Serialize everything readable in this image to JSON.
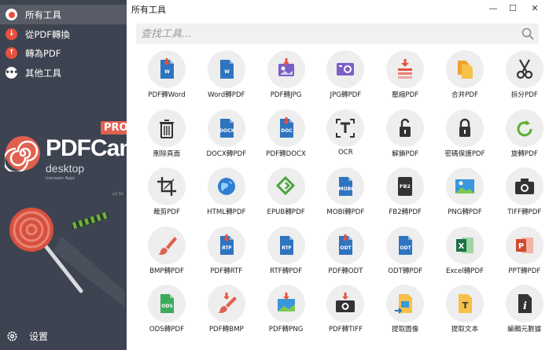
{
  "sidebar": {
    "items": [
      {
        "label": "所有工具",
        "icon": "all-tools-icon"
      },
      {
        "label": "從PDF轉換",
        "icon": "from-pdf-icon"
      },
      {
        "label": "轉為PDF",
        "icon": "to-pdf-icon"
      },
      {
        "label": "其他工具",
        "icon": "more-icon"
      }
    ],
    "logo": {
      "brand": "PDFCandy",
      "sub": "desktop",
      "badge": "PRO",
      "tiny": "Icecream Apps"
    },
    "version": "v2.91",
    "settings_label": "设置"
  },
  "window": {
    "title": "所有工具",
    "minimize": "—",
    "maximize": "☐",
    "close": "✕"
  },
  "search": {
    "placeholder": "查找工具..."
  },
  "colors": {
    "sidebar": "#3d4350",
    "active": "#575c66",
    "accent": "#e8513f",
    "word_blue": "#2f74c0",
    "excel_green": "#1e7145",
    "ppt_red": "#d04a2b"
  },
  "tools": [
    {
      "label": "PDF轉Word",
      "icon": "pdf-to-word-icon"
    },
    {
      "label": "Word轉PDF",
      "icon": "word-to-pdf-icon"
    },
    {
      "label": "PDF轉JPG",
      "icon": "pdf-to-jpg-icon"
    },
    {
      "label": "JPG轉PDF",
      "icon": "jpg-to-pdf-icon"
    },
    {
      "label": "壓縮PDF",
      "icon": "compress-icon"
    },
    {
      "label": "合并PDF",
      "icon": "merge-icon"
    },
    {
      "label": "拆分PDF",
      "icon": "scissors-icon"
    },
    {
      "label": "刪除頁面",
      "icon": "trash-icon"
    },
    {
      "label": "DOCX轉PDF",
      "icon": "docx-to-pdf-icon"
    },
    {
      "label": "PDF轉DOCX",
      "icon": "pdf-to-docx-icon"
    },
    {
      "label": "OCR",
      "icon": "ocr-icon"
    },
    {
      "label": "解鎖PDF",
      "icon": "unlock-icon"
    },
    {
      "label": "密碼保護PDF",
      "icon": "lock-icon"
    },
    {
      "label": "旋轉PDF",
      "icon": "rotate-icon"
    },
    {
      "label": "裁剪PDF",
      "icon": "crop-icon"
    },
    {
      "label": "HTML轉PDF",
      "icon": "html-globe-icon"
    },
    {
      "label": "EPUB轉PDF",
      "icon": "epub-icon"
    },
    {
      "label": "MOBI轉PDF",
      "icon": "mobi-icon"
    },
    {
      "label": "FB2轉PDF",
      "icon": "fb2-icon"
    },
    {
      "label": "PNG轉PDF",
      "icon": "png-image-icon"
    },
    {
      "label": "TIFF轉PDF",
      "icon": "camera-icon"
    },
    {
      "label": "BMP轉PDF",
      "icon": "paintbrush-icon"
    },
    {
      "label": "PDF轉RTF",
      "icon": "pdf-to-rtf-icon"
    },
    {
      "label": "RTF轉PDF",
      "icon": "rtf-to-pdf-icon"
    },
    {
      "label": "PDF轉ODT",
      "icon": "pdf-to-odt-icon"
    },
    {
      "label": "ODT轉PDF",
      "icon": "odt-to-pdf-icon"
    },
    {
      "label": "Excel轉PDF",
      "icon": "excel-icon"
    },
    {
      "label": "PPT轉PDF",
      "icon": "powerpoint-icon"
    },
    {
      "label": "ODS轉PDF",
      "icon": "ods-icon"
    },
    {
      "label": "PDF轉BMP",
      "icon": "pdf-to-bmp-icon"
    },
    {
      "label": "PDF轉PNG",
      "icon": "pdf-to-png-icon"
    },
    {
      "label": "PDF轉TIFF",
      "icon": "pdf-to-tiff-icon"
    },
    {
      "label": "提取圖像",
      "icon": "extract-image-icon"
    },
    {
      "label": "提取文本",
      "icon": "extract-text-icon"
    },
    {
      "label": "編輯元數據",
      "icon": "info-icon"
    }
  ]
}
